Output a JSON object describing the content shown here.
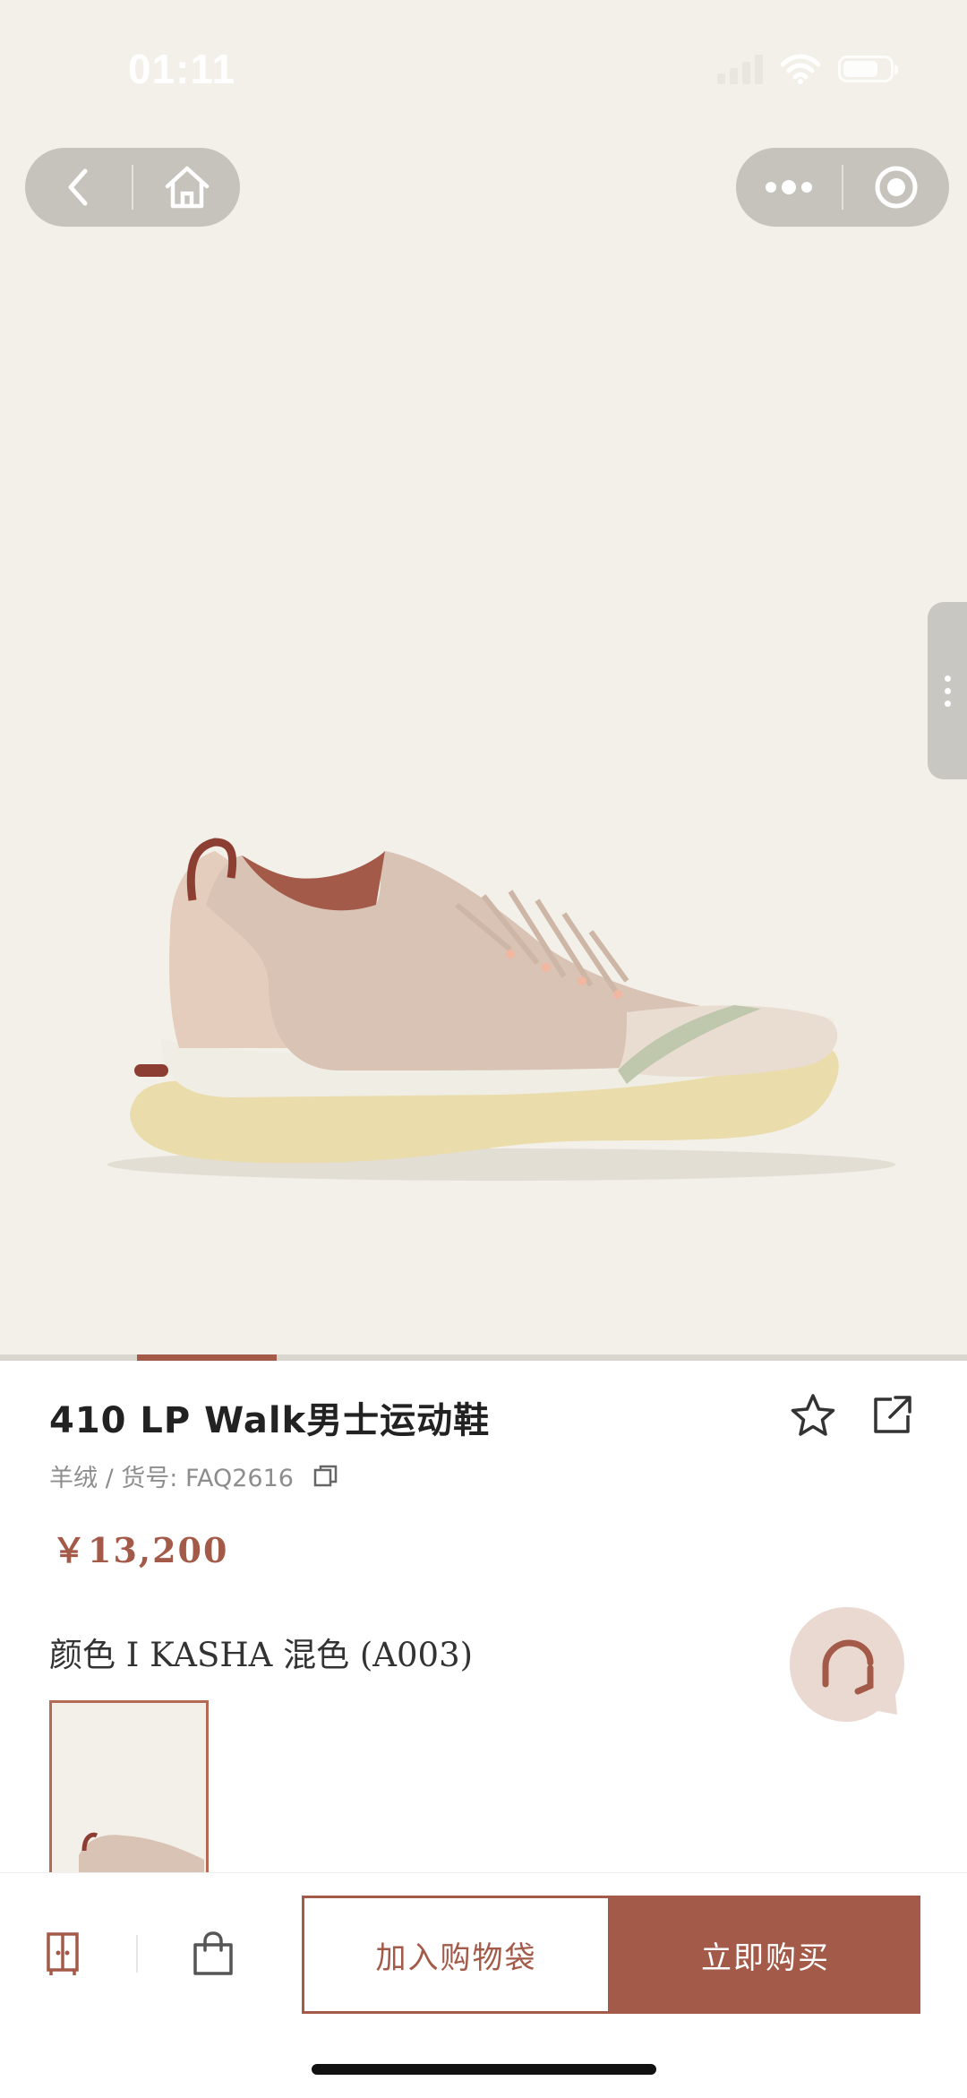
{
  "status_bar": {
    "time": "01:11"
  },
  "product": {
    "title": "410 LP Walk男士运动鞋",
    "material_sku": "羊绒 / 货号: FAQ2616",
    "price": "￥13,200",
    "color_label": "颜色 I KASHA 混色 (A003)"
  },
  "gallery": {
    "progress": 0.2
  },
  "actions": {
    "add_to_bag": "加入购物袋",
    "buy_now": "立即购买"
  },
  "colors": {
    "accent": "#a35a48",
    "hero_background": "#f3f0e9"
  },
  "icons": {
    "back": "chevron-left-icon",
    "home": "home-icon",
    "more": "more-dots-icon",
    "record": "target-icon",
    "favorite": "star-icon",
    "share": "share-icon",
    "copy": "copy-icon",
    "chat": "chat-icon",
    "wardrobe": "wardrobe-icon",
    "bag": "bag-icon"
  }
}
